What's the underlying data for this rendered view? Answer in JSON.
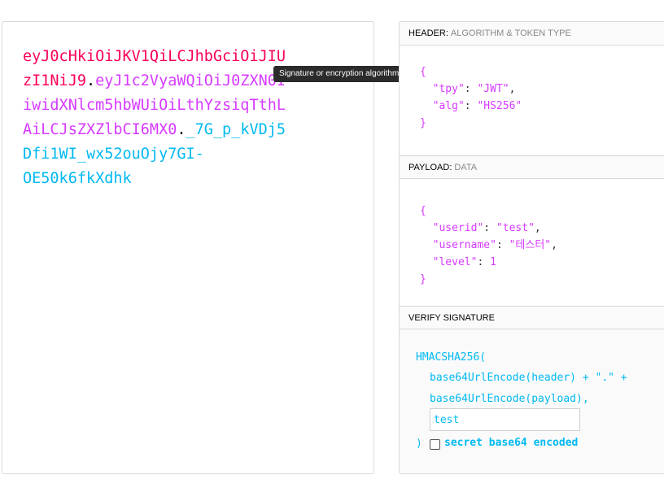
{
  "encoded": {
    "lines": [
      [
        {
          "t": "eyJ0cHkiOiJKV1QiLCJhbGciOiJIU",
          "c": "red"
        }
      ],
      [
        {
          "t": "zI1NiJ9",
          "c": "red"
        },
        {
          "t": ".",
          "c": "dot"
        },
        {
          "t": "eyJ1c2VyaWQiOiJ0ZXN0I",
          "c": "purple"
        }
      ],
      [
        {
          "t": "iwidXNlcm5hbWUiOiLthYzsiqTthL",
          "c": "purple"
        }
      ],
      [
        {
          "t": "AiLCJsZXZlbCI6MX0",
          "c": "purple"
        },
        {
          "t": ".",
          "c": "dot"
        },
        {
          "t": "_7G_p_kVDj5",
          "c": "cyan"
        }
      ],
      [
        {
          "t": "Dfi1WI_wx52ouOjy7GI-",
          "c": "cyan"
        }
      ],
      [
        {
          "t": "OE50k6fkXdhk",
          "c": "cyan"
        }
      ]
    ]
  },
  "tooltip": "Signature or encryption algorithm",
  "header_section": {
    "title": "HEADER:",
    "subtitle": "ALGORITHM & TOKEN TYPE",
    "open": "{",
    "close": "}",
    "fields": [
      {
        "key": "\"tpy\"",
        "value": "\"JWT\"",
        "comma": ","
      },
      {
        "key": "\"alg\"",
        "value": "\"HS256\"",
        "comma": ""
      }
    ]
  },
  "payload_section": {
    "title": "PAYLOAD:",
    "subtitle": "DATA",
    "open": "{",
    "close": "}",
    "fields": [
      {
        "key": "\"userid\"",
        "value": "\"test\"",
        "comma": ","
      },
      {
        "key": "\"username\"",
        "value": "\"테스터\"",
        "comma": ","
      },
      {
        "key": "\"level\"",
        "value": "1",
        "comma": ""
      }
    ]
  },
  "verify_section": {
    "title": "VERIFY SIGNATURE",
    "line1": "HMACSHA256(",
    "line2": "base64UrlEncode(header) + \".\" +",
    "line3": "base64UrlEncode(payload),",
    "secret_value": "test",
    "close_paren": ")",
    "checkbox_label": "secret base64 encoded"
  },
  "colors": {
    "red": "#fb015b",
    "purple": "#d63aff",
    "cyan": "#00b9f1"
  }
}
